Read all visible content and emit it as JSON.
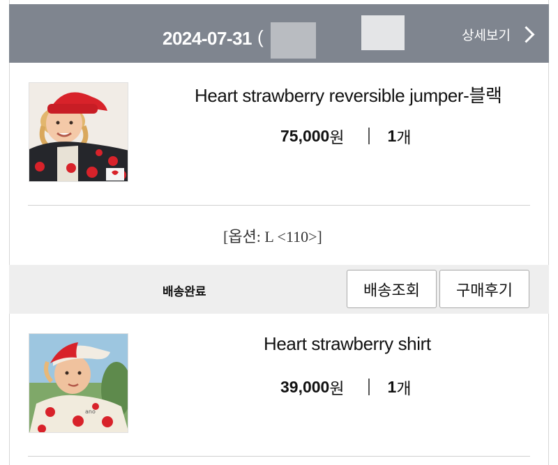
{
  "order": {
    "date": "2024-07-31",
    "date_suffix": "(",
    "detail_link": "상세보기"
  },
  "items": [
    {
      "title": "Heart strawberry reversible jumper-블랙",
      "price": "75,000",
      "currency": "원",
      "quantity": "1",
      "quantity_unit": "개",
      "option": "[옵션: L <110>]"
    },
    {
      "title": "Heart strawberry shirt",
      "price": "39,000",
      "currency": "원",
      "quantity": "1",
      "quantity_unit": "개"
    }
  ],
  "shipment": {
    "status": "배송완료",
    "track_button": "배송조회",
    "review_button": "구매후기"
  },
  "colors": {
    "header_bg": "#7f858f",
    "status_bar_bg": "#eeeeee",
    "hat_red": "#d8222a"
  },
  "icons": {
    "detail": "chevron-right-icon"
  }
}
